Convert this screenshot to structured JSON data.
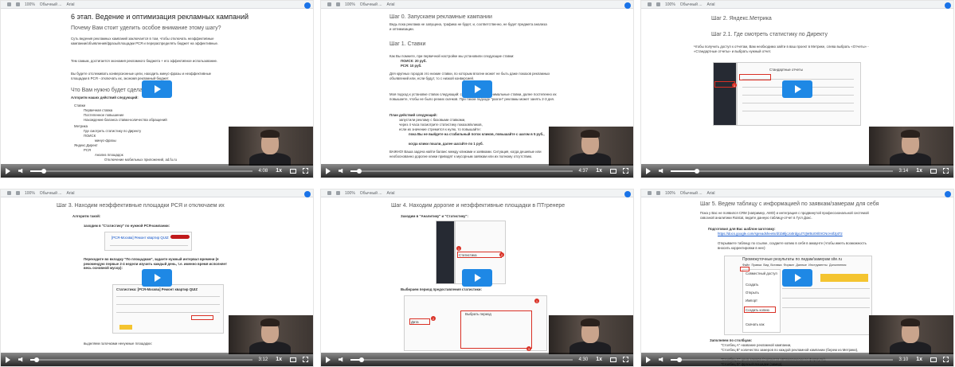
{
  "toolbar": {
    "zoom": "100%",
    "style": "Обычный ...",
    "font": "Arial"
  },
  "tiles": [
    {
      "heading": "6 этап. Ведение и оптимизация рекламных кампаний",
      "subheading": "Почему Вам стоит уделить особое внимание этому шагу?",
      "p1": "Суть ведения рекламных кампаний заключается в том, чтобы отключать неэффективные кампании/объявления/фразы/площадки РСЯ и перераспределять бюджет на эффективные.",
      "p2": "Тем самым, достигается экономия рекламного бюджета + его эффективное использование.",
      "p3": "Вы будете отслеживать конверсионные цели, находить минус-фразы и неэффективные площадки в РСЯ - отключать их, экономя рекламный бюджет.",
      "h2b": "Что Вам нужно будет сделать?",
      "algo": "Алгоритм наших действий следующий:",
      "list": [
        "Ставки",
        "Первичная ставка",
        "Постепенное повышение",
        "Нахождение баланса ставки-количества обращений",
        "Метрика",
        "Где смотреть статистику по Директу",
        "ПОИСК",
        "минус-фразы",
        "Яндекс.Директ",
        "РСЯ",
        "Анализ площадок",
        "Отключение мобильных приложений, ad.fu.ru",
        "Объявления",
        "Отключение площадок, где цена заявки выше запланированной (8000-1000руб.)"
      ],
      "time": "4:08",
      "speed": "1x",
      "progress": 0.06
    },
    {
      "heading": "Шаг 0. Запускаем рекламные кампании",
      "p1": "Ведь пока реклама не запущена, трафика не будет, и, соответственно, не будет предмета анализа и оптимизации.",
      "step": "Шаг 1. Ставки",
      "p2": "Как Вы помните, при первичной настройке мы установили следующие ставки:",
      "bul1": "ПОИСК: 20 руб.",
      "bul2": "РСЯ: 10 руб.",
      "p3": "Для крупных городов это низкие ставки, по которым вполне может не быть даже показов рекламных объявлений или, если будут, то с низкой конверсией.",
      "p4": "Моя подход к установке ставок следующий: сначала ставите минимальные ставки, далее постепенно их повышаете, чтобы не было резких скачков. При таком подходе \"разгон\" рекламы может занять 2-3 дня.",
      "p5": "План действий следующий:",
      "plan": [
        "запустили рекламу с базовыми ставками,",
        "через 4 часа посмотрите статистику показов/кликов,",
        "если их значение стремится к нулю, то повышайте:",
        "пока Вы не выйдете на стабильный поток кликов, повышайте с шагом в 5 руб.,",
        "когда клики пошли, далее шагайте по 1 руб."
      ],
      "p6": "ВАЖНО! Ваша задача найти баланс между кликами и заявками. Ситуация, когда дешевые или необоснованно дорогие клики приводят к мусорным заявкам или их полному отсутствию.",
      "time": "4:37",
      "speed": "1x",
      "progress": 0.04
    },
    {
      "heading": "Шаг 2. Яндекс.Метрика",
      "sub": "Шаг 2.1. Где смотреть статистику по Директу",
      "p1": "Чтобы получить доступ к отчетам, Вам необходимо зайти в ваш проект в Метрике, слева выбрать «Отчеты» - «Стандартные отчеты» и выбрать нужный отчет.",
      "shot_title": "Стандартные отчеты",
      "time": "3:14",
      "speed": "1x",
      "progress": 0.12
    },
    {
      "heading": "Шаг 3. Находим неэффективные площадки РСЯ и отключаем их",
      "algo": "Алгоритм такой:",
      "b1": "заходим в \"Статистику\" по нужной РСЯ-кампании:",
      "camp": "[РСЯ-Москва] Ремонт квартир QUIZ",
      "b2": "Переходите во вкладку \"По площадкам\", задаете нужный интервал времени (я рекомендую первые 2-4 недели изучить каждый день, т.е. именно время исполняет весь основной мусор):",
      "stats": "Статистика: [РСЯ-Москва] Ремонт квартир QUIZ",
      "b3": "выделяем галочками ненужные площадки:",
      "time": "3:12",
      "speed": "1x",
      "progress": 0.03
    },
    {
      "heading": "Шаг 4. Находим дорогие и неэффективные площадки в ПТгренере",
      "b1": "Заходим в \"Аналитику\" и \"Статистику\":",
      "b2": "Выбираем период предоставления статистики:",
      "menu1": "Статистика",
      "menu2": "Выбрать период",
      "menu3": "Дата",
      "time": "4:30",
      "speed": "1x",
      "progress": 0.05
    },
    {
      "heading": "Шаг 5. Ведем таблицу с информацией по заявкам/замерам для себя",
      "p1": "Пока у Вас не появился CRM (например, АМО) и интеграция с продвинутой профессиональной системой сквозной аналитики Roistat, ведите данную таблицу-отчет в Гугл Докс.",
      "b1": "Подготовил для Вас шаблон-заготовку:",
      "url": "https://docs.google.com/spreadsheets/d/1b8ljcJo0rdgoJ7zjW5U0Xl0rCNcH4fJpt72",
      "p2": "Открываете таблицу по ссылке, создаете копию в себя в аккаунте (чтобы иметь возможность вносить корректировки в нее):",
      "sheet_title": "Промежуточные результаты по лидам/замерам site.ru",
      "menu": [
        "Файл",
        "Правка",
        "Вид",
        "Вставка",
        "Формат",
        "Данные",
        "Инструменты",
        "Дополнения"
      ],
      "dd": [
        "Совместный доступ",
        "Создать",
        "Открыть",
        "Импорт",
        "Создать копию",
        "Скачать как"
      ],
      "fill": "Заполняем по столбцам:",
      "cols": [
        "\"Столбец А\" название рекламной кампании,",
        "\"Столбец B\" количество замеров по каждой рекламной кампании (берем из Метрики),",
        "\"Столбец С\" цена замера (считается автоматически по формуле),",
        "\"Столбец D\" фразы/площадки (замер),"
      ],
      "time": "3:10",
      "speed": "1x",
      "progress": 0.04
    }
  ]
}
